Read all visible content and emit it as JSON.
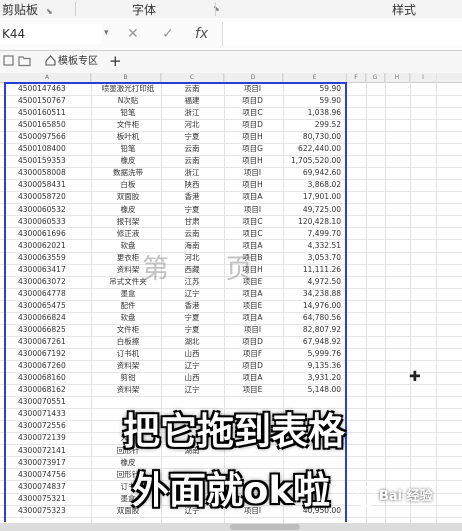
{
  "ribbon": {
    "group_clipboard": "剪贴板",
    "group_font": "字体",
    "group_styles": "样式"
  },
  "formula_bar": {
    "name_box": "K44",
    "cancel": "✕",
    "confirm": "✓",
    "fx": "fx",
    "value": ""
  },
  "tabs": {
    "workbook": "模板专区",
    "add": "+"
  },
  "columns": [
    "A",
    "B",
    "C",
    "D",
    "E",
    "F",
    "G",
    "H",
    "I"
  ],
  "rows": [
    [
      "4500147463",
      "喷墨激光打印纸",
      "云南",
      "项目I",
      "59.90"
    ],
    [
      "4500150767",
      "N次贴",
      "福建",
      "项目D",
      "59.90"
    ],
    [
      "4500160511",
      "铅笔",
      "浙江",
      "项目C",
      "1,038.96"
    ],
    [
      "4500165850",
      "文件柜",
      "河北",
      "项目D",
      "299.52"
    ],
    [
      "4500097566",
      "板叶机",
      "宁夏",
      "项目H",
      "80,730.00"
    ],
    [
      "4500108400",
      "铅笔",
      "云南",
      "项目G",
      "622,440.00"
    ],
    [
      "4500159353",
      "橡皮",
      "云南",
      "项目H",
      "1,705,520.00"
    ],
    [
      "4300058008",
      "数据洗带",
      "浙江",
      "项目I",
      "69,942.60"
    ],
    [
      "4300058431",
      "白板",
      "陕西",
      "项目H",
      "3,868.02"
    ],
    [
      "4300058720",
      "双面胶",
      "香港",
      "项目A",
      "17,901.00"
    ],
    [
      "4300060532",
      "橡皮",
      "宁夏",
      "项目I",
      "49,725.00"
    ],
    [
      "4300060533",
      "报刊架",
      "甘肃",
      "项目C",
      "120,428.10"
    ],
    [
      "4300061696",
      "修正液",
      "云南",
      "项目C",
      "7,499.70"
    ],
    [
      "4300062021",
      "软盘",
      "海南",
      "项目A",
      "4,332.51"
    ],
    [
      "4300063559",
      "更衣柜",
      "河北",
      "项目B",
      "3,053.70"
    ],
    [
      "4300063417",
      "资料架",
      "西藏",
      "项目H",
      "11,111.26"
    ],
    [
      "4300063072",
      "吊式文件夹",
      "江苏",
      "项目E",
      "4,972.50"
    ],
    [
      "4300064778",
      "墨盒",
      "辽宁",
      "项目A",
      "34,238.88"
    ],
    [
      "4300065475",
      "配件",
      "香港",
      "项目E",
      "14,976.00"
    ],
    [
      "4300066824",
      "软盘",
      "宁夏",
      "项目A",
      "64,780.56"
    ],
    [
      "4300066825",
      "文件柜",
      "宁夏",
      "项目I",
      "82,807.92"
    ],
    [
      "4300067261",
      "白板擦",
      "湖北",
      "项目D",
      "67,948.92"
    ],
    [
      "4300067192",
      "订书机",
      "山西",
      "项目F",
      "5,999.76"
    ],
    [
      "4300067260",
      "资料架",
      "辽宁",
      "项目D",
      "9,135.36"
    ],
    [
      "4300068160",
      "剪钳",
      "山西",
      "项目A",
      "3,931.20"
    ],
    [
      "4300068162",
      "资料架",
      "辽宁",
      "项目E",
      "5,148.00"
    ],
    [
      "4300070551",
      "",
      "",
      "",
      ""
    ],
    [
      "4300071433",
      "",
      "",
      "",
      ""
    ],
    [
      "4300072556",
      "",
      "",
      "",
      ""
    ],
    [
      "4300072139",
      "大头",
      "",
      "",
      ""
    ],
    [
      "4300072141",
      "回形针",
      "湖南",
      "",
      ""
    ],
    [
      "4300073917",
      "橡皮",
      "",
      "",
      ""
    ],
    [
      "4300074756",
      "回形针",
      "",
      "",
      ""
    ],
    [
      "4300074837",
      "订书",
      "",
      "",
      ""
    ],
    [
      "4300075321",
      "墨盒",
      "",
      "",
      ""
    ],
    [
      "4300075323",
      "双面胶",
      "辽宁",
      "项目I",
      "40,950.00"
    ]
  ],
  "watermark": "第 页",
  "caption": {
    "line1": "把它拖到表格",
    "line2": "外面就ok啦"
  },
  "branding": "Bai 经验",
  "colors": {
    "print_area_border": "#2a3fd6"
  }
}
